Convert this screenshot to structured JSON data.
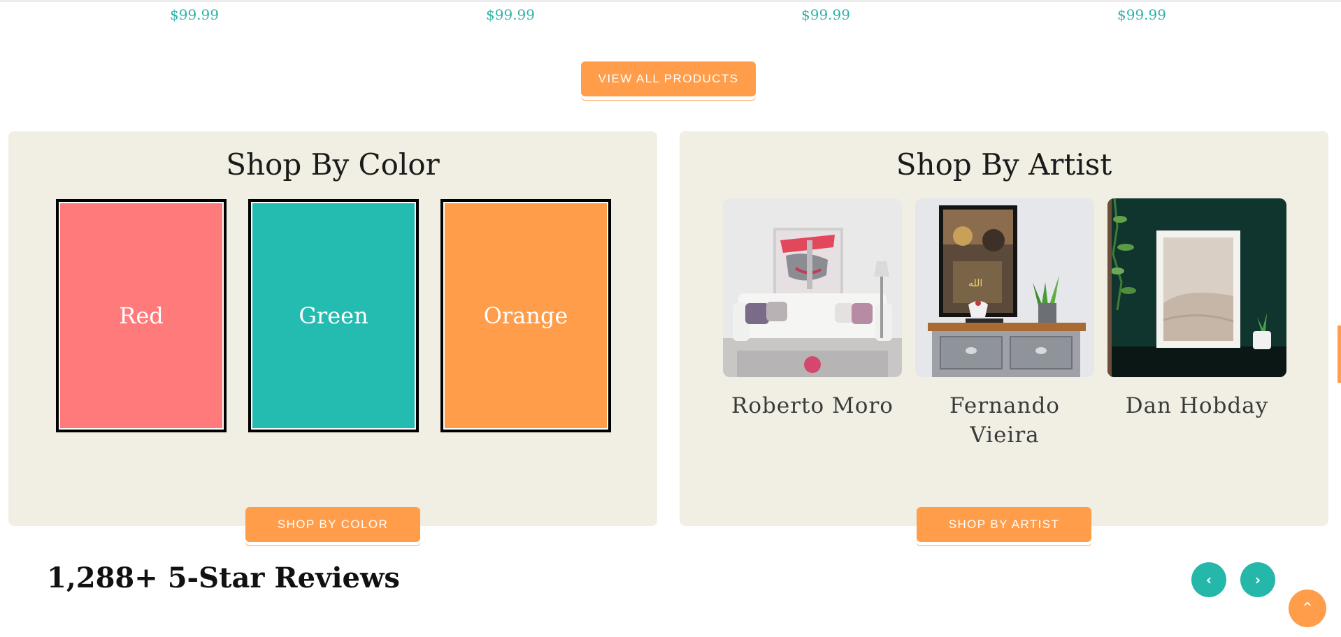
{
  "products": {
    "prices": [
      "$99.99",
      "$99.99",
      "$99.99",
      "$99.99"
    ],
    "view_all_label": "VIEW ALL PRODUCTS"
  },
  "shop_by_color": {
    "title": "Shop By Color",
    "swatches": [
      {
        "label": "Red",
        "color": "#ff7b7b"
      },
      {
        "label": "Green",
        "color": "#24bcb0"
      },
      {
        "label": "Orange",
        "color": "#ff9d4a"
      }
    ],
    "button_label": "SHOP BY COLOR"
  },
  "shop_by_artist": {
    "title": "Shop By Artist",
    "artists": [
      {
        "name": "Roberto Moro"
      },
      {
        "name": "Fernando Vieira"
      },
      {
        "name": "Dan Hobday"
      }
    ],
    "button_label": "SHOP BY ARTIST"
  },
  "reviews": {
    "title": "1,288+ 5-Star Reviews",
    "prev_icon": "chevron-left-icon",
    "next_icon": "chevron-right-icon"
  },
  "back_to_top_icon": "chevron-up-icon",
  "colors": {
    "accent_orange": "#ff9d4a",
    "accent_teal": "#25b8aa",
    "panel_bg": "#f1efe3",
    "price_teal": "#2fb2a6"
  }
}
